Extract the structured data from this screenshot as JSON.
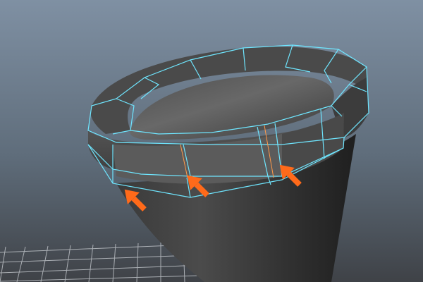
{
  "viewport": {
    "background_top": "#7d8fa2",
    "background_bottom": "#4b5057",
    "grid_color": "#c9cdd2",
    "wireframe_color": "#6fe6ff",
    "selected_edge_color": "#ff8a3d",
    "arrow_color": "#ff6a1a"
  },
  "scene": {
    "object": "polygon-cup-mesh",
    "annotation_arrows": 3
  }
}
